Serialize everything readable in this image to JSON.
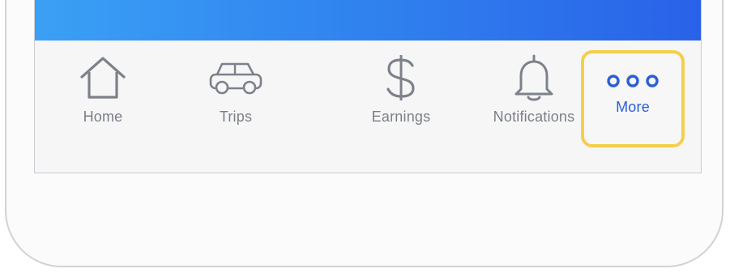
{
  "tabbar": {
    "items": [
      {
        "id": "home",
        "label": "Home",
        "icon": "house-icon",
        "active": false
      },
      {
        "id": "trips",
        "label": "Trips",
        "icon": "car-icon",
        "active": false
      },
      {
        "id": "earnings",
        "label": "Earnings",
        "icon": "dollar-icon",
        "active": false
      },
      {
        "id": "notifications",
        "label": "Notifications",
        "icon": "bell-icon",
        "active": false
      },
      {
        "id": "more",
        "label": "More",
        "icon": "more-dots-icon",
        "active": true
      }
    ]
  },
  "colors": {
    "header_gradient_start": "#3aa0f5",
    "header_gradient_end": "#2962e8",
    "inactive_label": "#7b7f86",
    "active_label": "#2a5fd6",
    "highlight_border": "#f4cf4a",
    "icon_stroke": "#7d8189"
  }
}
